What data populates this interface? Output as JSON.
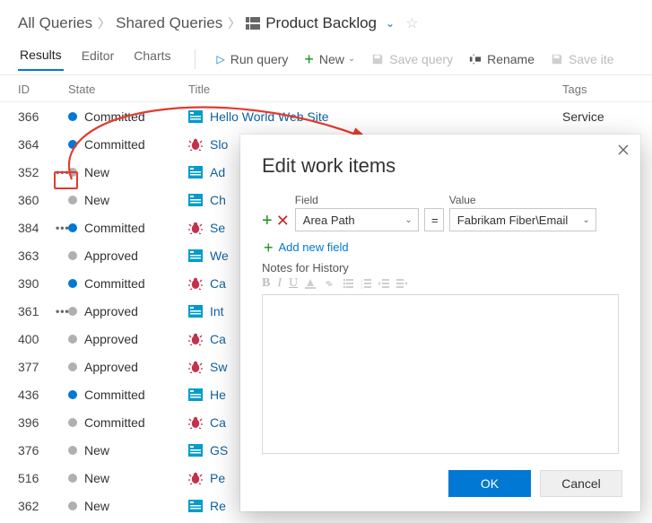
{
  "breadcrumb": {
    "root": "All Queries",
    "folder": "Shared Queries",
    "query": "Product Backlog"
  },
  "tabs": {
    "results": "Results",
    "editor": "Editor",
    "charts": "Charts"
  },
  "commands": {
    "run": "Run query",
    "new": "New",
    "save": "Save query",
    "rename": "Rename",
    "save_items": "Save ite"
  },
  "columns": {
    "id": "ID",
    "state": "State",
    "title": "Title",
    "tags": "Tags"
  },
  "states": {
    "committed": "Committed",
    "new": "New",
    "approved": "Approved"
  },
  "rows": [
    {
      "id": "366",
      "state": "committed",
      "dot": "blue",
      "icon": "pbi",
      "title": "Hello World Web Site",
      "tags": "Service"
    },
    {
      "id": "364",
      "state": "committed",
      "dot": "blue",
      "icon": "bug",
      "title": "Slo"
    },
    {
      "id": "352",
      "state": "new",
      "dot": "grey",
      "icon": "pbi",
      "title": "Ad",
      "kebab": true
    },
    {
      "id": "360",
      "state": "new",
      "dot": "grey",
      "icon": "pbi",
      "title": "Ch"
    },
    {
      "id": "384",
      "state": "committed",
      "dot": "blue",
      "icon": "bug",
      "title": "Se",
      "kebab": true
    },
    {
      "id": "363",
      "state": "approved",
      "dot": "grey",
      "icon": "pbi",
      "title": "We"
    },
    {
      "id": "390",
      "state": "committed",
      "dot": "blue",
      "icon": "bug",
      "title": "Ca"
    },
    {
      "id": "361",
      "state": "approved",
      "dot": "grey",
      "icon": "pbi",
      "title": "Int",
      "kebab": true
    },
    {
      "id": "400",
      "state": "approved",
      "dot": "grey",
      "icon": "bug",
      "title": "Ca"
    },
    {
      "id": "377",
      "state": "approved",
      "dot": "grey",
      "icon": "bug",
      "title": "Sw"
    },
    {
      "id": "436",
      "state": "committed",
      "dot": "blue",
      "icon": "pbi",
      "title": "He"
    },
    {
      "id": "396",
      "state": "committed",
      "dot": "grey",
      "icon": "bug",
      "title": "Ca"
    },
    {
      "id": "376",
      "state": "new",
      "dot": "grey",
      "icon": "pbi",
      "title": "GS"
    },
    {
      "id": "516",
      "state": "new",
      "dot": "grey",
      "icon": "bug",
      "title": "Pe"
    },
    {
      "id": "362",
      "state": "new",
      "dot": "grey",
      "icon": "pbi",
      "title": "Re"
    }
  ],
  "dialog": {
    "title": "Edit work items",
    "field_label": "Field",
    "value_label": "Value",
    "field_value": "Area Path",
    "operator": "=",
    "value_value": "Fabrikam Fiber\\Email",
    "add_new": "Add new field",
    "notes_label": "Notes for History",
    "ok": "OK",
    "cancel": "Cancel"
  },
  "rte": {
    "b": "B",
    "i": "I",
    "u": "U"
  }
}
